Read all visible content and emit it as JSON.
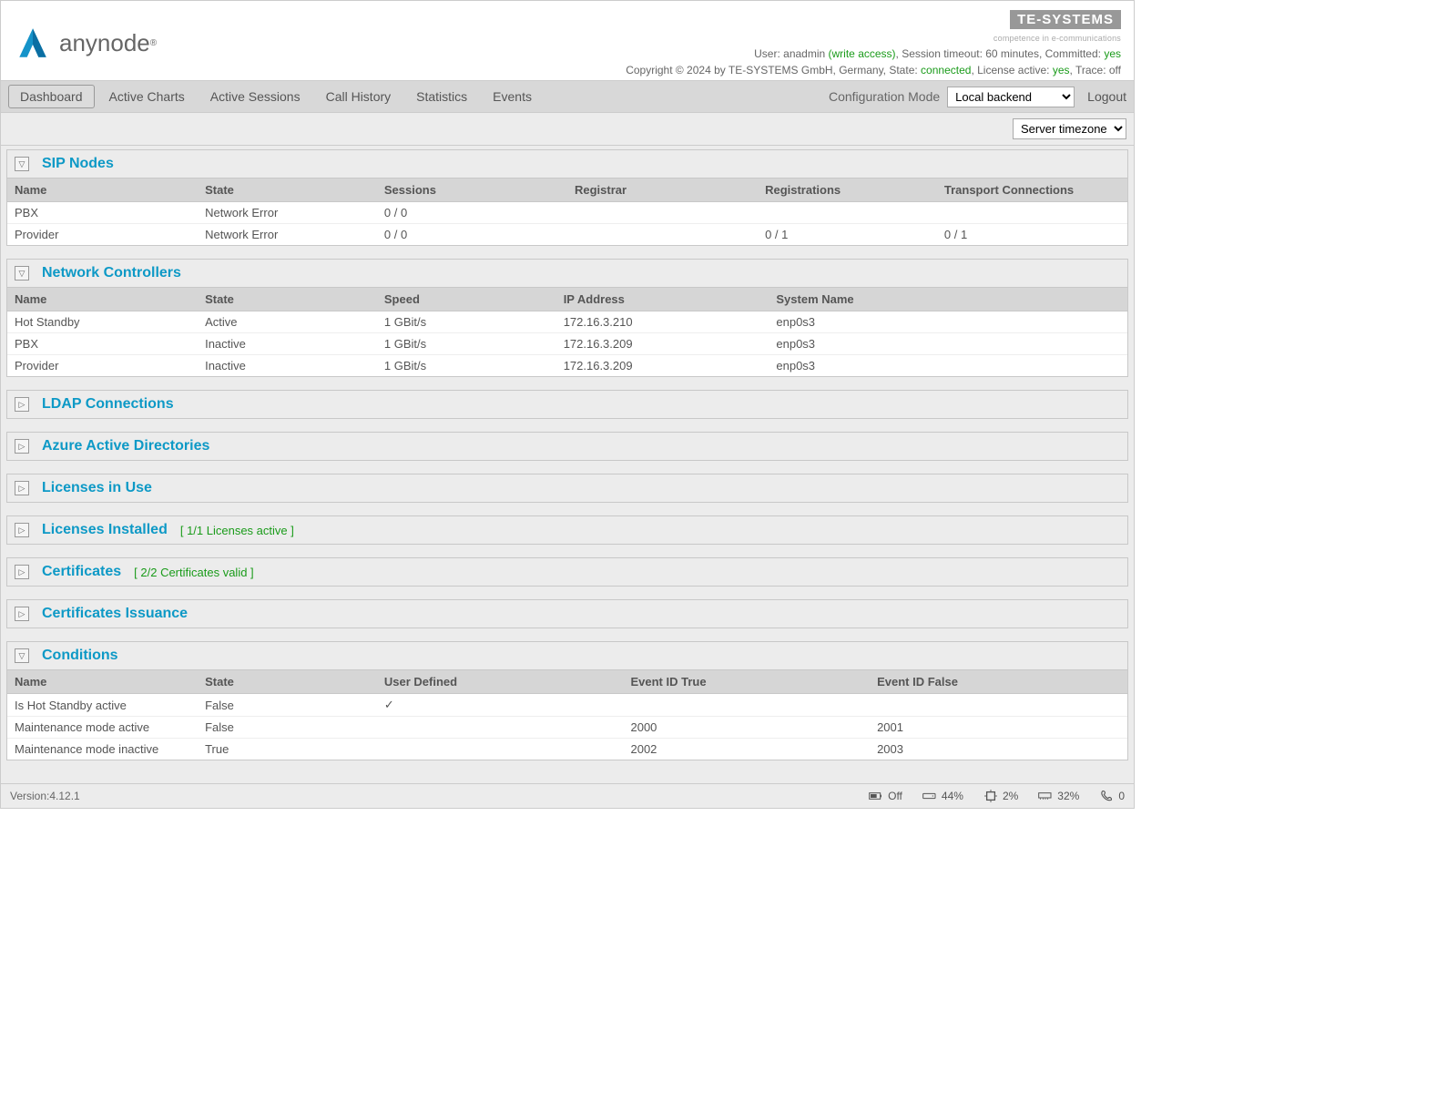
{
  "header": {
    "brand": "anynode",
    "te_logo": "TE-SYSTEMS",
    "te_sub": "competence in e-communications",
    "user_label": "User: ",
    "user": "anadmin",
    "access": " (write access)",
    "session_label": ", Session timeout: ",
    "session": "60 minutes",
    "committed_label": ", Committed: ",
    "committed": "yes",
    "copyright": "Copyright © 2024 by TE-SYSTEMS GmbH, Germany, State: ",
    "state": "connected",
    "lic_label": ", License active: ",
    "lic": "yes",
    "trace_label": ", Trace: ",
    "trace": "off"
  },
  "nav": {
    "items": [
      "Dashboard",
      "Active Charts",
      "Active Sessions",
      "Call History",
      "Statistics",
      "Events"
    ],
    "cfg_label": "Configuration Mode",
    "cfg_option": "Local backend",
    "logout": "Logout",
    "tz_option": "Server timezone"
  },
  "sip": {
    "title": "SIP Nodes",
    "cols": [
      "Name",
      "State",
      "Sessions",
      "Registrar",
      "Registrations",
      "Transport Connections"
    ],
    "rows": [
      {
        "name": "PBX",
        "state": "Network Error",
        "state_cls": "red",
        "sessions": "0 / 0",
        "registrar": "",
        "reg": "",
        "tc": ""
      },
      {
        "name": "Provider",
        "state": "Network Error",
        "state_cls": "red",
        "sessions": "0 / 0",
        "registrar": "",
        "reg": "0 / 1",
        "reg_cls": "red",
        "tc": "0 / 1",
        "tc_cls": "red"
      }
    ]
  },
  "nc": {
    "title": "Network Controllers",
    "cols": [
      "Name",
      "State",
      "Speed",
      "IP Address",
      "System Name"
    ],
    "rows": [
      {
        "name": "Hot Standby",
        "state": "Active",
        "state_cls": "green",
        "speed": "1 GBit/s",
        "ip": "172.16.3.210",
        "sys": "enp0s3"
      },
      {
        "name": "PBX",
        "state": "Inactive",
        "state_cls": "red",
        "speed": "1 GBit/s",
        "ip": "172.16.3.209",
        "sys": "enp0s3"
      },
      {
        "name": "Provider",
        "state": "Inactive",
        "state_cls": "red",
        "speed": "1 GBit/s",
        "ip": "172.16.3.209",
        "sys": "enp0s3"
      }
    ]
  },
  "collapsed": {
    "ldap": "LDAP Connections",
    "azure": "Azure Active Directories",
    "lic_use": "Licenses in Use",
    "lic_inst": "Licenses Installed",
    "lic_inst_annot": "[ 1/1 Licenses active ]",
    "cert": "Certificates",
    "cert_annot": "[ 2/2 Certificates valid ]",
    "cert_iss": "Certificates Issuance"
  },
  "cond": {
    "title": "Conditions",
    "cols": [
      "Name",
      "State",
      "User Defined",
      "Event ID True",
      "Event ID False"
    ],
    "rows": [
      {
        "name": "Is Hot Standby active",
        "state": "False",
        "state_cls": "",
        "ud": "✓",
        "et": "",
        "ef": ""
      },
      {
        "name": "Maintenance mode active",
        "state": "False",
        "state_cls": "",
        "ud": "",
        "et": "2000",
        "ef": "2001"
      },
      {
        "name": "Maintenance mode inactive",
        "state": "True",
        "state_cls": "blue",
        "ud": "",
        "et": "2002",
        "ef": "2003"
      }
    ]
  },
  "footer": {
    "version_label": "Version:  ",
    "version": "4.12.1",
    "battery": "Off",
    "disk": "44%",
    "cpu": "2%",
    "mem": "32%",
    "calls": "0"
  }
}
